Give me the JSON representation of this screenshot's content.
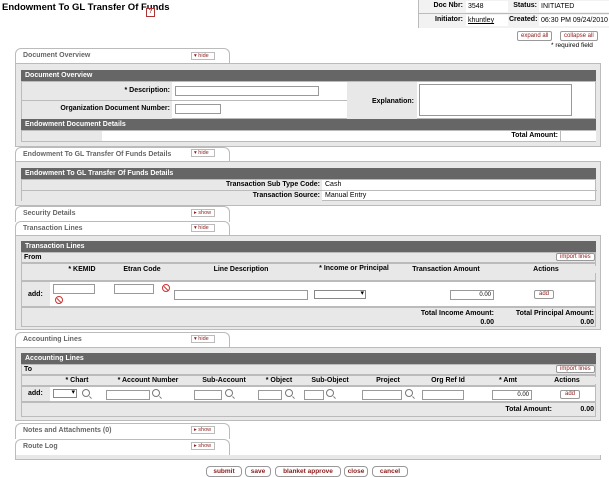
{
  "header": {
    "title": "Endowment To GL Transfer Of Funds",
    "help": "?",
    "doc_nbr_label": "Doc Nbr:",
    "doc_nbr": "3548",
    "status_label": "Status:",
    "status": "INITIATED",
    "initiator_label": "Initiator:",
    "initiator": "khuntley",
    "created_label": "Created:",
    "created": "06:30 PM 09/24/2010"
  },
  "top_buttons": {
    "expand": "expand all",
    "collapse": "collapse all",
    "required": "* required field"
  },
  "toggle": {
    "hide": "▾ hide",
    "show": "▸ show"
  },
  "document_overview": {
    "tab": "Document Overview",
    "band": "Document Overview",
    "description_label": "* Description:",
    "org_doc_label": "Organization Document Number:",
    "explanation_label": "Explanation:",
    "endow_band": "Endowment Document Details",
    "total_amount_label": "Total Amount:"
  },
  "transfer_details": {
    "tab": "Endowment To GL Transfer Of Funds Details",
    "band": "Endowment To GL Transfer Of Funds Details",
    "sub_type_label": "Transaction Sub Type Code:",
    "sub_type_value": "Cash",
    "source_label": "Transaction Source:",
    "source_value": "Manual Entry"
  },
  "security": {
    "tab": "Security Details"
  },
  "transaction_lines": {
    "tab": "Transaction Lines",
    "band": "Transaction Lines",
    "from": "From",
    "import": "import lines",
    "columns": [
      "* KEMID",
      "Etran Code",
      "Line Description",
      "* Income or Principal",
      "Transaction Amount",
      "Actions"
    ],
    "add_label": "add:",
    "amount_value": "0.00",
    "add_button": "add",
    "total_income_label": "Total Income Amount:",
    "total_income_value": "0.00",
    "total_principal_label": "Total Principal Amount:",
    "total_principal_value": "0.00"
  },
  "accounting_lines": {
    "tab": "Accounting Lines",
    "band": "Accounting Lines",
    "to": "To",
    "import": "import lines",
    "columns": [
      "* Chart",
      "* Account Number",
      "Sub-Account",
      "* Object",
      "Sub-Object",
      "Project",
      "Org Ref Id",
      "* Amt",
      "Actions"
    ],
    "add_label": "add:",
    "amt_value": "0.00",
    "add_button": "add",
    "total_label": "Total Amount:",
    "total_value": "0.00"
  },
  "notes": {
    "tab": "Notes and Attachments (0)"
  },
  "route_log": {
    "tab": "Route Log"
  },
  "bottom_buttons": [
    "submit",
    "save",
    "blanket approve",
    "close",
    "cancel"
  ]
}
